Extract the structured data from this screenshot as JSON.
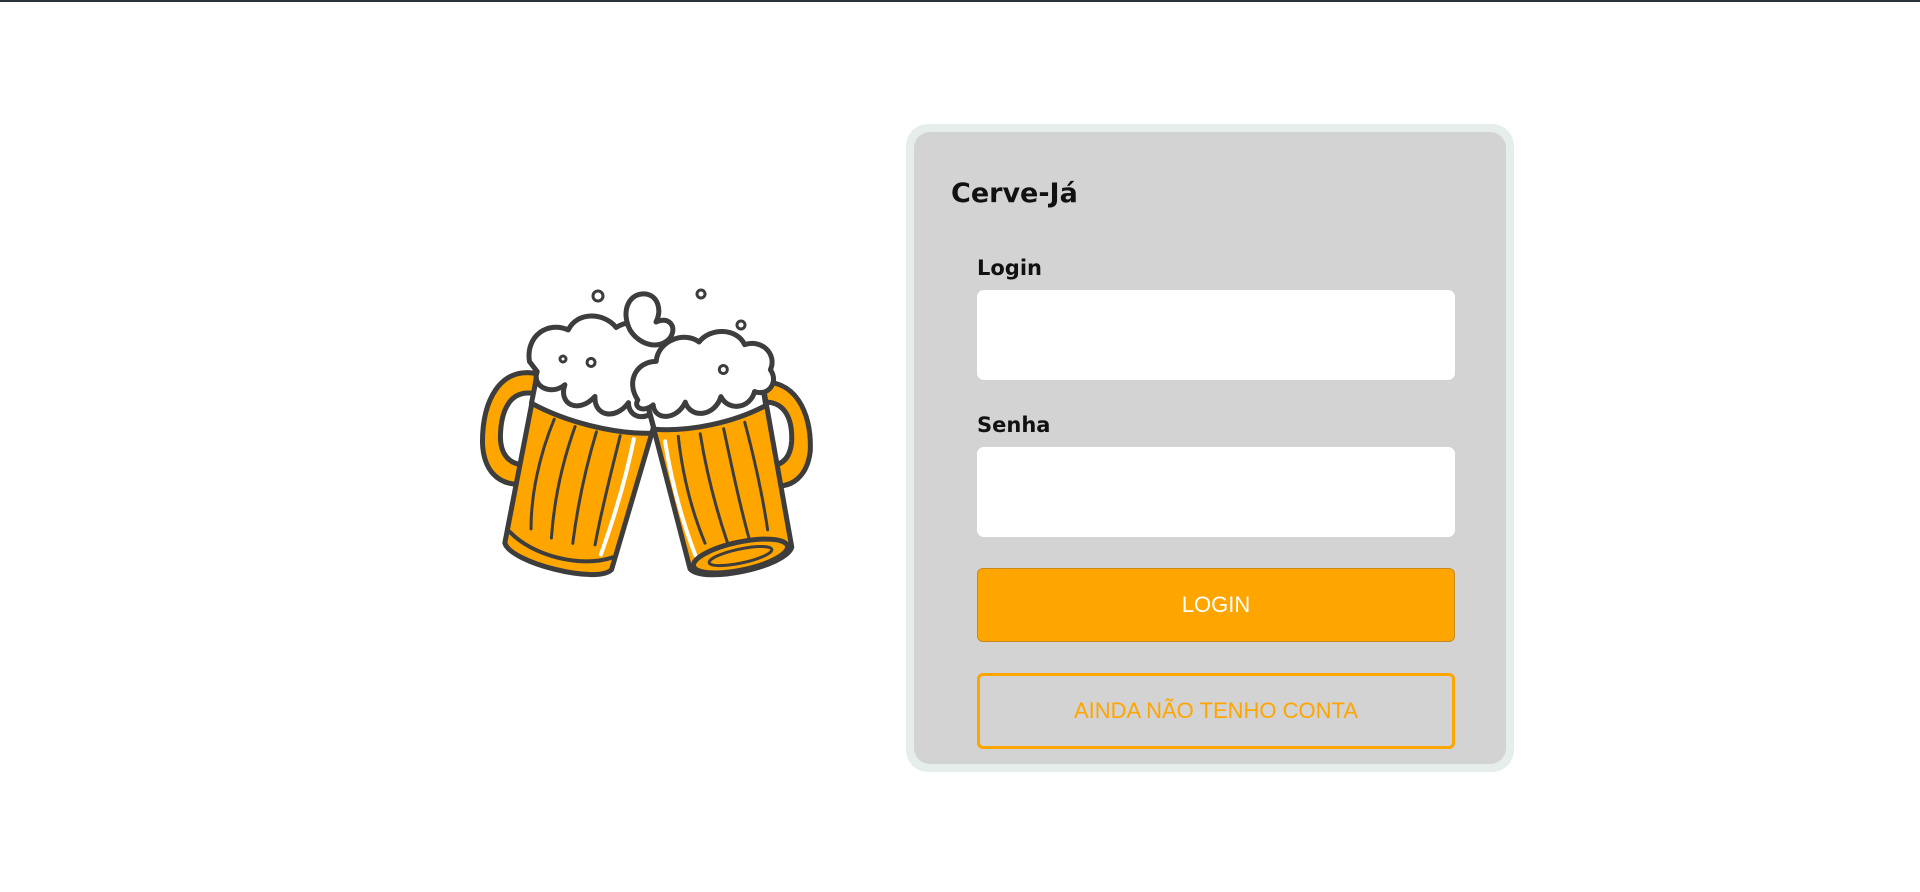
{
  "app": {
    "brand": "Cerve-Já"
  },
  "form": {
    "login_label": "Login",
    "login_value": "",
    "password_label": "Senha",
    "password_value": "",
    "login_button": "LOGIN",
    "signup_button": "AINDA NÃO TENHO CONTA"
  },
  "illustration": {
    "icon": "beer-mugs-toast-icon"
  },
  "colors": {
    "accent": "#ffa500",
    "card_background": "#d3d3d3",
    "card_border": "#e6eeec",
    "input_background": "#ffffff"
  }
}
